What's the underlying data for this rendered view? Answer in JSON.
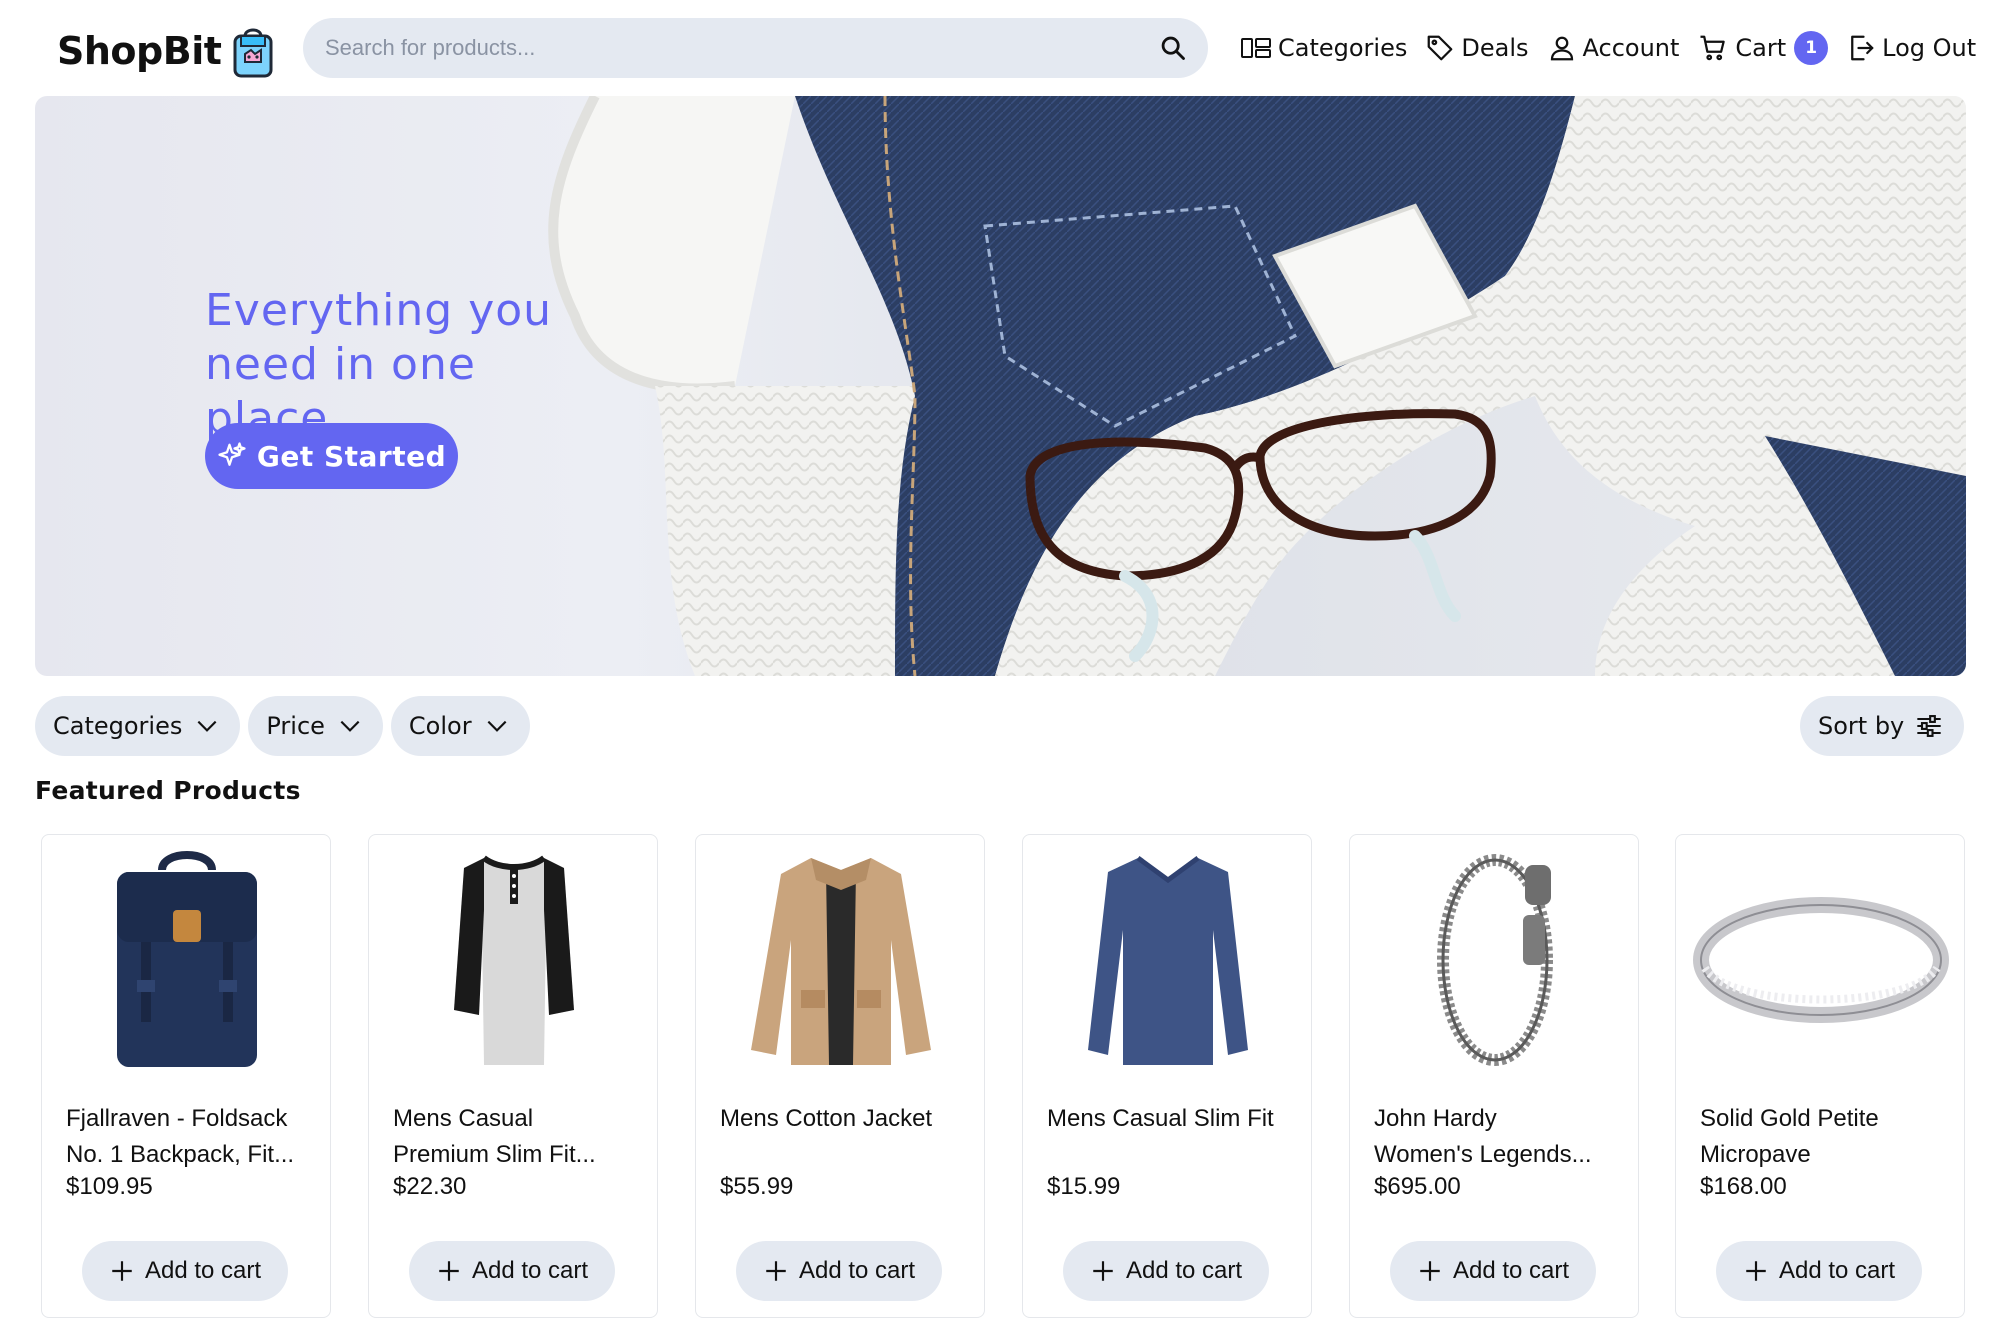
{
  "header": {
    "logo": "ShopBit",
    "search_placeholder": "Search for products...",
    "nav": {
      "categories": "Categories",
      "deals": "Deals",
      "account": "Account",
      "cart": "Cart",
      "cart_count": "1",
      "logout": "Log Out"
    }
  },
  "hero": {
    "title_line1": "Everything you",
    "title_line2": "need in one place.",
    "cta": "Get Started"
  },
  "filters": {
    "categories": "Categories",
    "price": "Price",
    "color": "Color",
    "sort": "Sort by"
  },
  "section_title": "Featured Products",
  "products": [
    {
      "name_l1": "Fjallraven - Foldsack",
      "name_l2": "No. 1 Backpack, Fit...",
      "price": "$109.95",
      "btn": "Add to cart"
    },
    {
      "name_l1": "Mens Casual",
      "name_l2": "Premium Slim Fit...",
      "price": "$22.30",
      "btn": "Add to cart"
    },
    {
      "name_l1": "Mens Cotton Jacket",
      "name_l2": "",
      "price": "$55.99",
      "btn": "Add to cart"
    },
    {
      "name_l1": "Mens Casual Slim Fit",
      "name_l2": "",
      "price": "$15.99",
      "btn": "Add to cart"
    },
    {
      "name_l1": "John Hardy",
      "name_l2": "Women's Legends...",
      "price": "$695.00",
      "btn": "Add to cart"
    },
    {
      "name_l1": "Solid Gold Petite",
      "name_l2": "Micropave",
      "price": "$168.00",
      "btn": "Add to cart"
    }
  ],
  "colors": {
    "accent": "#6366f1",
    "pill_bg": "#e4e9f1"
  },
  "icons": [
    "shopping-bag-logo-icon",
    "search-icon",
    "categories-icon",
    "tag-icon",
    "user-icon",
    "cart-icon",
    "logout-icon",
    "sparkles-icon",
    "chevron-down-icon",
    "sliders-icon",
    "plus-icon"
  ]
}
